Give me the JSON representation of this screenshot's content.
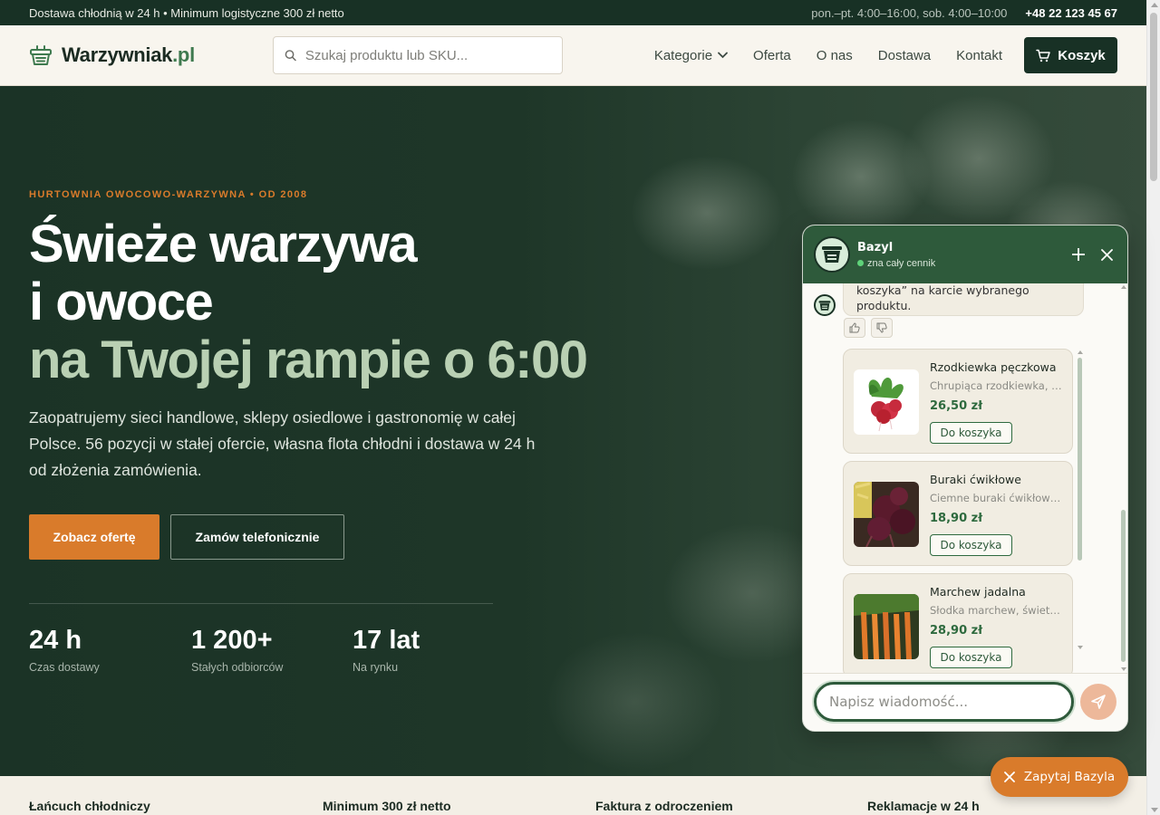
{
  "topbar": {
    "promo": "Dostawa chłodnią w 24 h • Minimum logistyczne 300 zł netto",
    "hours": "pon.–pt. 4:00–16:00, sob. 4:00–10:00",
    "phone": "+48 22 123 45 67"
  },
  "header": {
    "logo_name": "Warzywniak",
    "logo_tld": ".pl",
    "search_placeholder": "Szukaj produktu lub SKU...",
    "nav": {
      "categories": "Kategorie",
      "offer": "Oferta",
      "about": "O nas",
      "delivery": "Dostawa",
      "contact": "Kontakt"
    },
    "cart_label": "Koszyk"
  },
  "hero": {
    "eyebrow": "HURTOWNIA OWOCOWO-WARZYWNA • OD 2008",
    "title_line1": "Świeże warzywa",
    "title_line2": "i owoce",
    "title_line3": "na Twojej rampie o 6:00",
    "lead": "Zaopatrujemy sieci handlowe, sklepy osiedlowe i gastronomię w całej Polsce. 56 pozycji w stałej ofercie, własna flota chłodni i dostawa w 24 h od złożenia zamówienia.",
    "cta_primary": "Zobacz ofertę",
    "cta_secondary": "Zamów telefonicznie",
    "stats": [
      {
        "value": "24 h",
        "label": "Czas dostawy"
      },
      {
        "value": "1 200+",
        "label": "Stałych odbiorców"
      },
      {
        "value": "17 lat",
        "label": "Na rynku"
      }
    ]
  },
  "features": [
    "Łańcuch chłodniczy",
    "Minimum 300 zł netto",
    "Faktura z odroczeniem",
    "Reklamacje w 24 h"
  ],
  "chat": {
    "bot_name": "Bazyl",
    "bot_status": "zna cały cennik",
    "message_partial_top": "koszyka” na karcie wybranego",
    "message_partial_end": "produktu.",
    "products": [
      {
        "name": "Rzodkiewka pęczkowa",
        "desc": "Chrupiąca rzodkiewka, świeża",
        "price": "26,50 zł",
        "add": "Do koszyka"
      },
      {
        "name": "Buraki ćwikłowe",
        "desc": "Ciemne buraki ćwikłowe, słodkie",
        "price": "18,90 zł",
        "add": "Do koszyka"
      },
      {
        "name": "Marchew jadalna",
        "desc": "Słodka marchew, świetna do soków",
        "price": "28,90 zł",
        "add": "Do koszyka"
      }
    ],
    "input_placeholder": "Napisz wiadomość...",
    "launcher_label": "Zapytaj Bazyla"
  }
}
